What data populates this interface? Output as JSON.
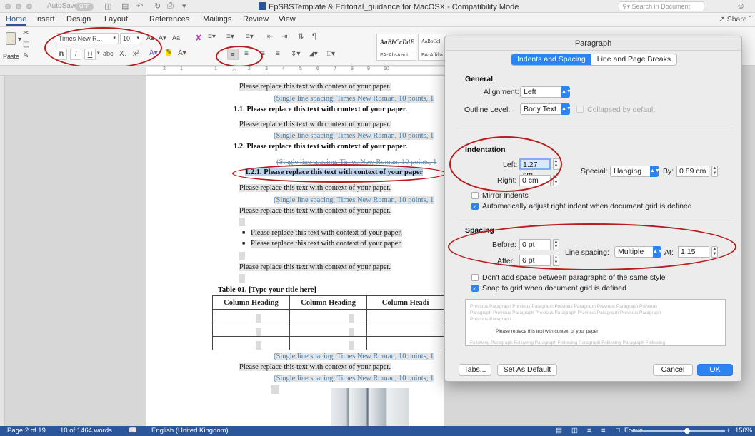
{
  "titlebar": {
    "autosave_label": "AutoSave",
    "autosave_state": "OFF",
    "document_title": "EpSBSTemplate & Editorial_guidance for MacOSX  -  Compatibility Mode",
    "search_placeholder": "Search in Document"
  },
  "ribbon_tabs": {
    "items": [
      "Home",
      "Insert",
      "Design",
      "Layout",
      "References",
      "Mailings",
      "Review",
      "View"
    ],
    "active": "Home",
    "share_label": "Share"
  },
  "ribbon": {
    "paste_label": "Paste",
    "font_name": "Times New R...",
    "font_size": "10",
    "bold": "B",
    "italic": "I",
    "underline": "U",
    "strikethrough": "abc",
    "subscript": "X₂",
    "superscript": "x²",
    "styles": [
      {
        "sample": "AaBbCcDdE",
        "name": "FA-Abstract..."
      },
      {
        "sample": "AaBbCcI",
        "name": "FA-Affilia"
      }
    ],
    "ruler_numbers": [
      "2",
      "1",
      "1",
      "2",
      "3",
      "4",
      "5",
      "6",
      "7",
      "8",
      "9",
      "10"
    ]
  },
  "document": {
    "lines": [
      "Please replace this text with context of your paper.",
      "(Single line spacing, Times New Roman, 10 points, 1",
      "1.1.  Please replace this text with context of your paper.",
      "Please replace this text with context of your paper.",
      "(Single line spacing, Times New Roman, 10 points, 1",
      "1.2.  Please replace this text with context of your paper.",
      "(Single line spacing, Times New Roman, 10 points, 1",
      "1.2.1. Please replace this text with context of your paper",
      "Please replace this text with context of your paper.",
      "(Single line spacing, Times New Roman, 10 points, 1",
      "Please replace this text with context of your paper.",
      "Please replace this text with context of your paper.",
      "Please replace this text with context of your paper.",
      "Please replace this text with context of your paper.",
      "(Single line spacing, Times New Roman, 10 points, 1",
      "Please replace this text with context of your paper.",
      "(Single line spacing, Times New Roman, 10 points, 1"
    ],
    "table_caption": "Table 01.  [Type your title here]",
    "table_headers": [
      "Column Heading",
      "Column Heading",
      "Column Headi"
    ]
  },
  "statusbar": {
    "page": "Page 2 of 19",
    "words": "10 of 1464 words",
    "language": "English (United Kingdom)",
    "focus": "Focus",
    "zoom": "150%"
  },
  "dialog": {
    "title": "Paragraph",
    "tabs": [
      "Indents and Spacing",
      "Line and Page Breaks"
    ],
    "general": {
      "heading": "General",
      "alignment_label": "Alignment:",
      "alignment_value": "Left",
      "outline_label": "Outline Level:",
      "outline_value": "Body Text",
      "collapsed_label": "Collapsed by default"
    },
    "indentation": {
      "heading": "Indentation",
      "left_label": "Left:",
      "left_value": "1.27 cm",
      "right_label": "Right:",
      "right_value": "0 cm",
      "special_label": "Special:",
      "special_value": "Hanging",
      "by_label": "By:",
      "by_value": "0.89 cm",
      "mirror_label": "Mirror Indents",
      "auto_adjust_label": "Automatically adjust right indent when document grid is defined"
    },
    "spacing": {
      "heading": "Spacing",
      "before_label": "Before:",
      "before_value": "0 pt",
      "after_label": "After:",
      "after_value": "6 pt",
      "line_spacing_label": "Line spacing:",
      "line_spacing_value": "Multiple",
      "at_label": "At:",
      "at_value": "1.15",
      "dont_add_label": "Don't add space between paragraphs of the same style",
      "snap_label": "Snap to grid when document grid is defined"
    },
    "preview": {
      "previous_1": "Previous Paragraph Previous Paragraph Previous Paragraph Previous Paragraph Previous",
      "previous_2": "Paragraph Previous Paragraph Previous Paragraph Previous Paragraph Previous Paragraph",
      "previous_3": "Previous Paragraph",
      "current": "Please replace this text with context of your paper",
      "following": "Following Paragraph Following Paragraph Following Paragraph Following Paragraph Following"
    },
    "buttons": {
      "tabs": "Tabs...",
      "set_default": "Set As Default",
      "cancel": "Cancel",
      "ok": "OK"
    }
  },
  "colors": {
    "word_blue": "#2b579a",
    "accent_blue": "#2d83f2",
    "annotation_red": "#b81d1d"
  }
}
